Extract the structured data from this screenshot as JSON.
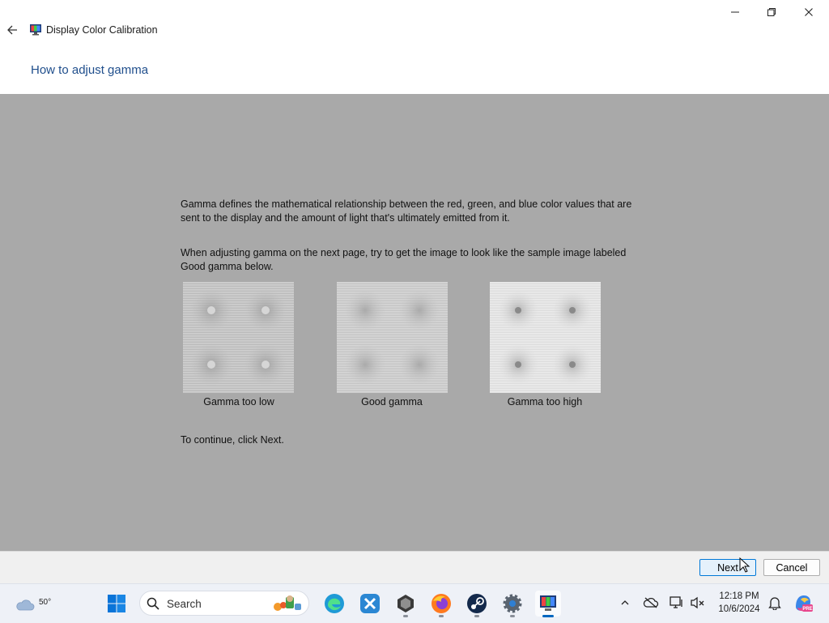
{
  "window": {
    "title": "Display Color Calibration",
    "page_heading": "How to adjust gamma"
  },
  "content": {
    "paragraph1": "Gamma defines the mathematical relationship between the red, green, and blue color values that are sent to the display and the amount of light that's ultimately emitted from it.",
    "paragraph2": "When adjusting gamma on the next page, try to get the image to look like the sample image labeled Good gamma below.",
    "samples": [
      {
        "caption": "Gamma too low"
      },
      {
        "caption": "Good gamma"
      },
      {
        "caption": "Gamma too high"
      }
    ],
    "continue_text": "To continue, click Next."
  },
  "buttons": {
    "next": "Next",
    "cancel": "Cancel"
  },
  "taskbar": {
    "weather_temp": "50°",
    "search_label": "Search",
    "pinned_icons": [
      "windows-start-icon",
      "search-icon",
      "edge-icon",
      "xbox-icon",
      "unity-icon",
      "firefox-icon",
      "steam-icon",
      "settings-icon",
      "display-color-calibration-icon"
    ],
    "time": "12:18 PM",
    "date": "10/6/2024"
  },
  "colors": {
    "content_background": "#a9a9a9",
    "heading_blue": "#1f4e8c",
    "accent": "#0078d7"
  }
}
